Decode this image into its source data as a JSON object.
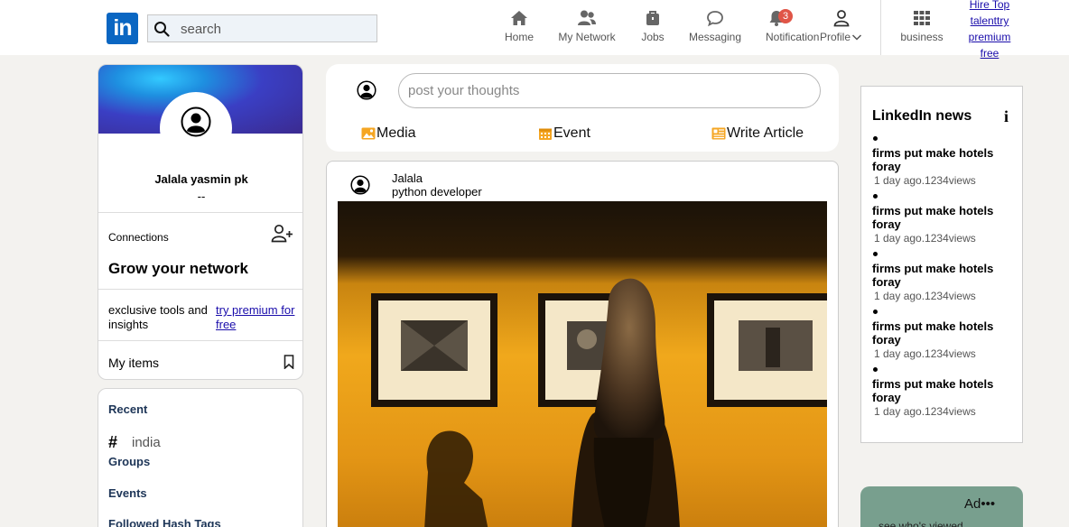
{
  "nav": {
    "logo_text": "in",
    "search_placeholder": "search",
    "items": [
      {
        "label": "Home"
      },
      {
        "label": "My Network"
      },
      {
        "label": "Jobs"
      },
      {
        "label": "Messaging"
      },
      {
        "label": "Notification",
        "badge": "3"
      },
      {
        "label": "Profile"
      },
      {
        "label": "business"
      }
    ],
    "premium_link": "Hire Top talenttry premium free"
  },
  "profile": {
    "name": "Jalala yasmin pk",
    "subtitle": "--",
    "connections_label": "Connections",
    "grow_label": "Grow your network",
    "exclusive_text": "exclusive tools and insights",
    "try_premium_link": "try premium for free",
    "my_items_label": "My items"
  },
  "recent": {
    "recent_label": "Recent",
    "hashtag_symbol": "#",
    "hashtag_item": "india",
    "groups_label": "Groups",
    "events_label": "Events",
    "followed_label": "Followed Hash Tags"
  },
  "compose": {
    "placeholder": "post your thoughts",
    "media_label": "Media",
    "event_label": "Event",
    "article_label": "Write Article"
  },
  "post": {
    "author": "Jalala",
    "headline": "python developer"
  },
  "news": {
    "title": "LinkedIn news",
    "info_symbol": "i",
    "items": [
      {
        "title": "firms put make hotels foray",
        "meta": "1 day ago.1234views"
      },
      {
        "title": "firms put make hotels foray",
        "meta": "1 day ago.1234views"
      },
      {
        "title": "firms put make hotels foray",
        "meta": "1 day ago.1234views"
      },
      {
        "title": "firms put make hotels foray",
        "meta": "1 day ago.1234views"
      },
      {
        "title": "firms put make hotels foray",
        "meta": "1 day ago.1234views"
      }
    ]
  },
  "ad": {
    "label": "Ad•••",
    "sub": "see who's viewed"
  },
  "colors": {
    "brand": "#0a66c2",
    "badge": "#e05547",
    "link": "#1a0dab",
    "ad_bg": "#789f8e"
  }
}
